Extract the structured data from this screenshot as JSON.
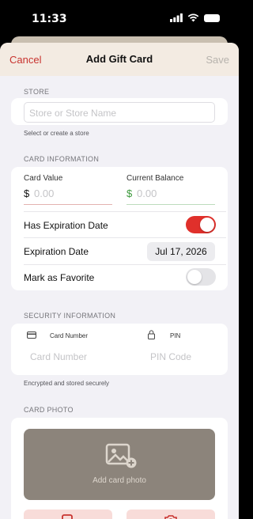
{
  "status_bar": {
    "time": "11:33",
    "icons": [
      "cellular-signal-icon",
      "wifi-icon",
      "battery-icon"
    ]
  },
  "nav": {
    "cancel_label": "Cancel",
    "title": "Add Gift Card",
    "save_label": "Save"
  },
  "store": {
    "header": "STORE",
    "placeholder": "Store or Store Name",
    "footer": "Select or create a store"
  },
  "card_info": {
    "header": "CARD INFORMATION",
    "card_value_label": "Card Value",
    "card_value_currency": "$",
    "card_value_placeholder": "0.00",
    "current_balance_label": "Current Balance",
    "current_balance_currency": "$",
    "current_balance_placeholder": "0.00",
    "has_expiration_label": "Has Expiration Date",
    "has_expiration_on": true,
    "expiration_label": "Expiration Date",
    "expiration_value": "Jul 17, 2026",
    "favorite_label": "Mark as Favorite",
    "favorite_on": false
  },
  "security": {
    "header": "SECURITY INFORMATION",
    "card_number_label": "Card Number",
    "card_number_placeholder": "Card Number",
    "pin_label": "PIN",
    "pin_placeholder": "PIN Code",
    "footer": "Encrypted and stored securely"
  },
  "photo": {
    "header": "CARD PHOTO",
    "add_label": "Add card photo"
  },
  "colors": {
    "accent": "#c8332f",
    "toggle_on": "#e0302b",
    "toggle_off": "#e4e4e7",
    "balance_green": "#3d9a3d",
    "nav_bg": "#f3ebe2",
    "photo_bg": "#8c847b"
  }
}
